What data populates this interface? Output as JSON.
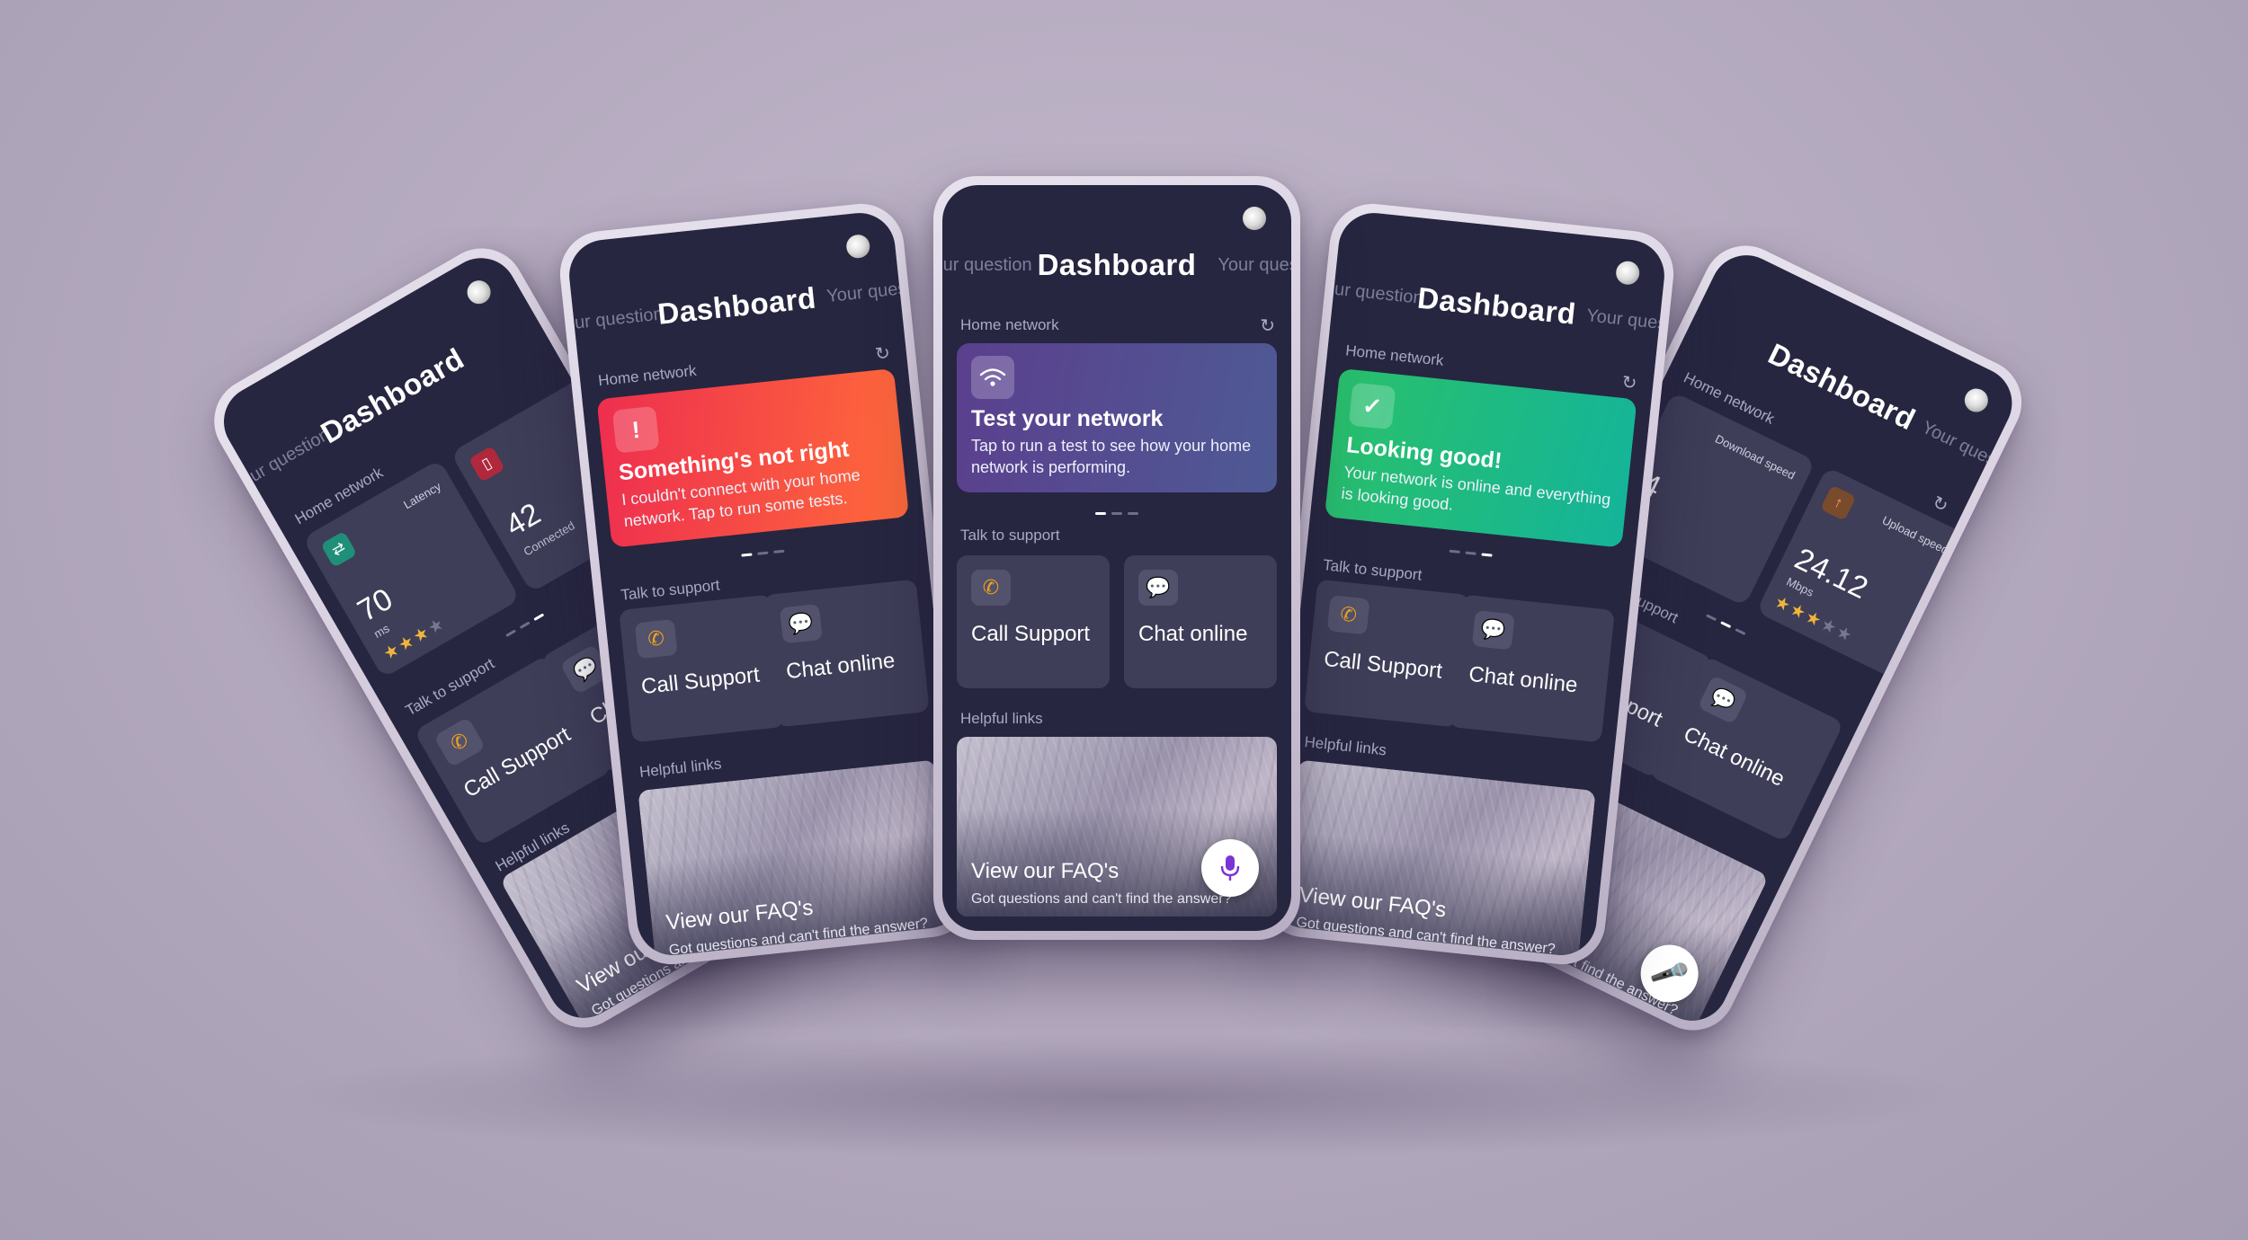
{
  "app": {
    "title": "Dashboard",
    "tab_left": "Your question",
    "tab_right": "Your question"
  },
  "home_network": {
    "label": "Home network",
    "refresh_icon": "refresh-icon"
  },
  "hero_cards": {
    "test": {
      "title": "Test your network",
      "description": "Tap to run a test to see how your home network is performing.",
      "icon": "wifi-icon"
    },
    "error": {
      "title": "Something's not right",
      "description": "I couldn't connect with your home network. Tap to run some tests.",
      "icon": "alert-icon"
    },
    "good": {
      "title": "Looking good!",
      "description": "Your network is online and everything is looking good.",
      "icon": "check-icon"
    }
  },
  "metrics": {
    "latency": {
      "label": "Latency",
      "value": "70",
      "unit": "ms",
      "rating": 3,
      "max_rating": 5
    },
    "connected": {
      "label": "Connected",
      "value": "42"
    },
    "download": {
      "label": "Download speed",
      "value": "4"
    },
    "upload": {
      "label": "Upload speed",
      "value": "24.12",
      "unit": "Mbps",
      "rating": 3,
      "max_rating": 5
    }
  },
  "support": {
    "label": "Talk to support",
    "call": {
      "label": "Call Support",
      "icon": "phone-icon"
    },
    "chat": {
      "label": "Chat online",
      "icon": "chat-icon"
    }
  },
  "helpful_links": {
    "label": "Helpful links",
    "faq_title": "View our FAQ's",
    "faq_subtitle": "Got questions and can't find the answer?"
  },
  "mic_icon": "microphone-icon",
  "colors": {
    "screen_bg": "#262640",
    "tile_bg": "#3e3e58",
    "accent_purple": "#7b33d6",
    "error_red": "#ee2e4f",
    "success_green": "#29c06b",
    "call_icon": "#f2a21e",
    "chat_icon": "#27c4b6"
  }
}
